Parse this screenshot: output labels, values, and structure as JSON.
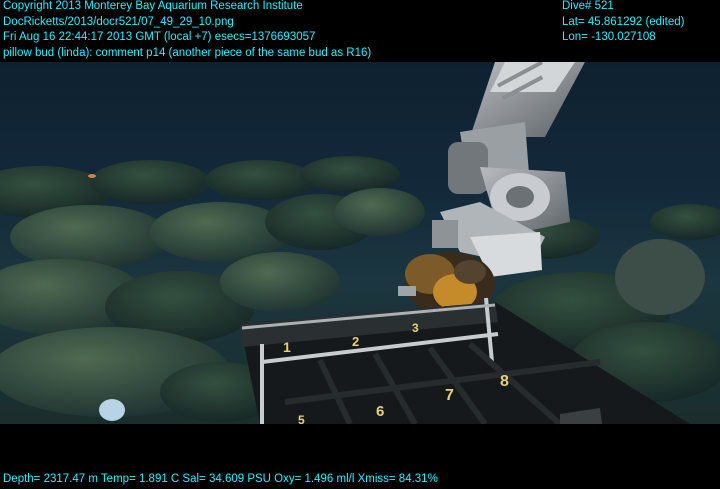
{
  "overlay": {
    "top_left": [
      "Copyright 2013 Monterey Bay Aquarium Research Institute",
      "DocRicketts/2013/docr521/07_49_29_10.png",
      "Fri Aug 16 22:44:17 2013 GMT (local +7)  esecs=1376693057",
      "pillow bud (linda): comment p14 (another piece of the same bud as R16)"
    ],
    "top_right": [
      "Dive# 521",
      "Lat= 45.861292 (edited)",
      "Lon= -130.027108"
    ],
    "bottom": "Depth= 2317.47 m  Temp= 1.891 C  Sal= 34.609 PSU  Oxy= 1.496 ml/l  Xmiss= 84.31%"
  },
  "scene": {
    "crate_numbers": [
      "1",
      "2",
      "3",
      "6",
      "7",
      "8",
      "5"
    ]
  },
  "colors": {
    "overlay_text": "#29f0ff",
    "background": "#000000"
  }
}
